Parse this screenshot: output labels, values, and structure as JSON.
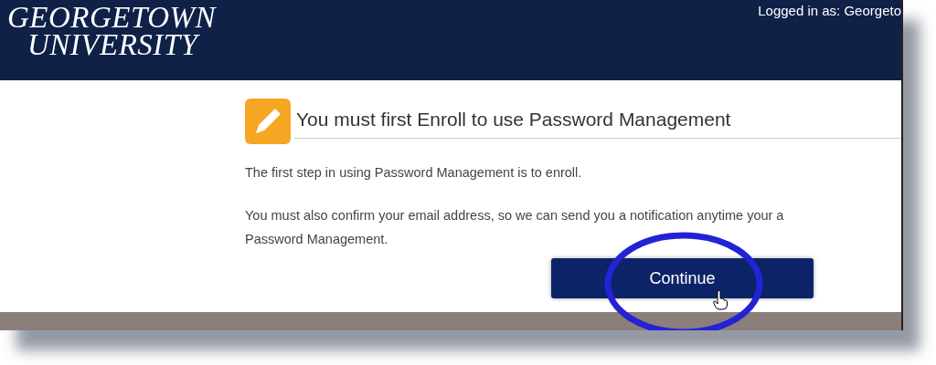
{
  "header": {
    "logo_lines": [
      "GEORGETOWN",
      "UNIVERSITY"
    ],
    "login_status": "Logged in as: Georgeto"
  },
  "notice": {
    "heading": "You must first Enroll to use Password Management",
    "paragraphs": [
      [
        "The first step in using Password Management is to enroll."
      ],
      [
        "You must also confirm your email address, so we can send you a notification anytime your a",
        "Password Management."
      ]
    ],
    "button": {
      "label": "Continue"
    }
  }
}
